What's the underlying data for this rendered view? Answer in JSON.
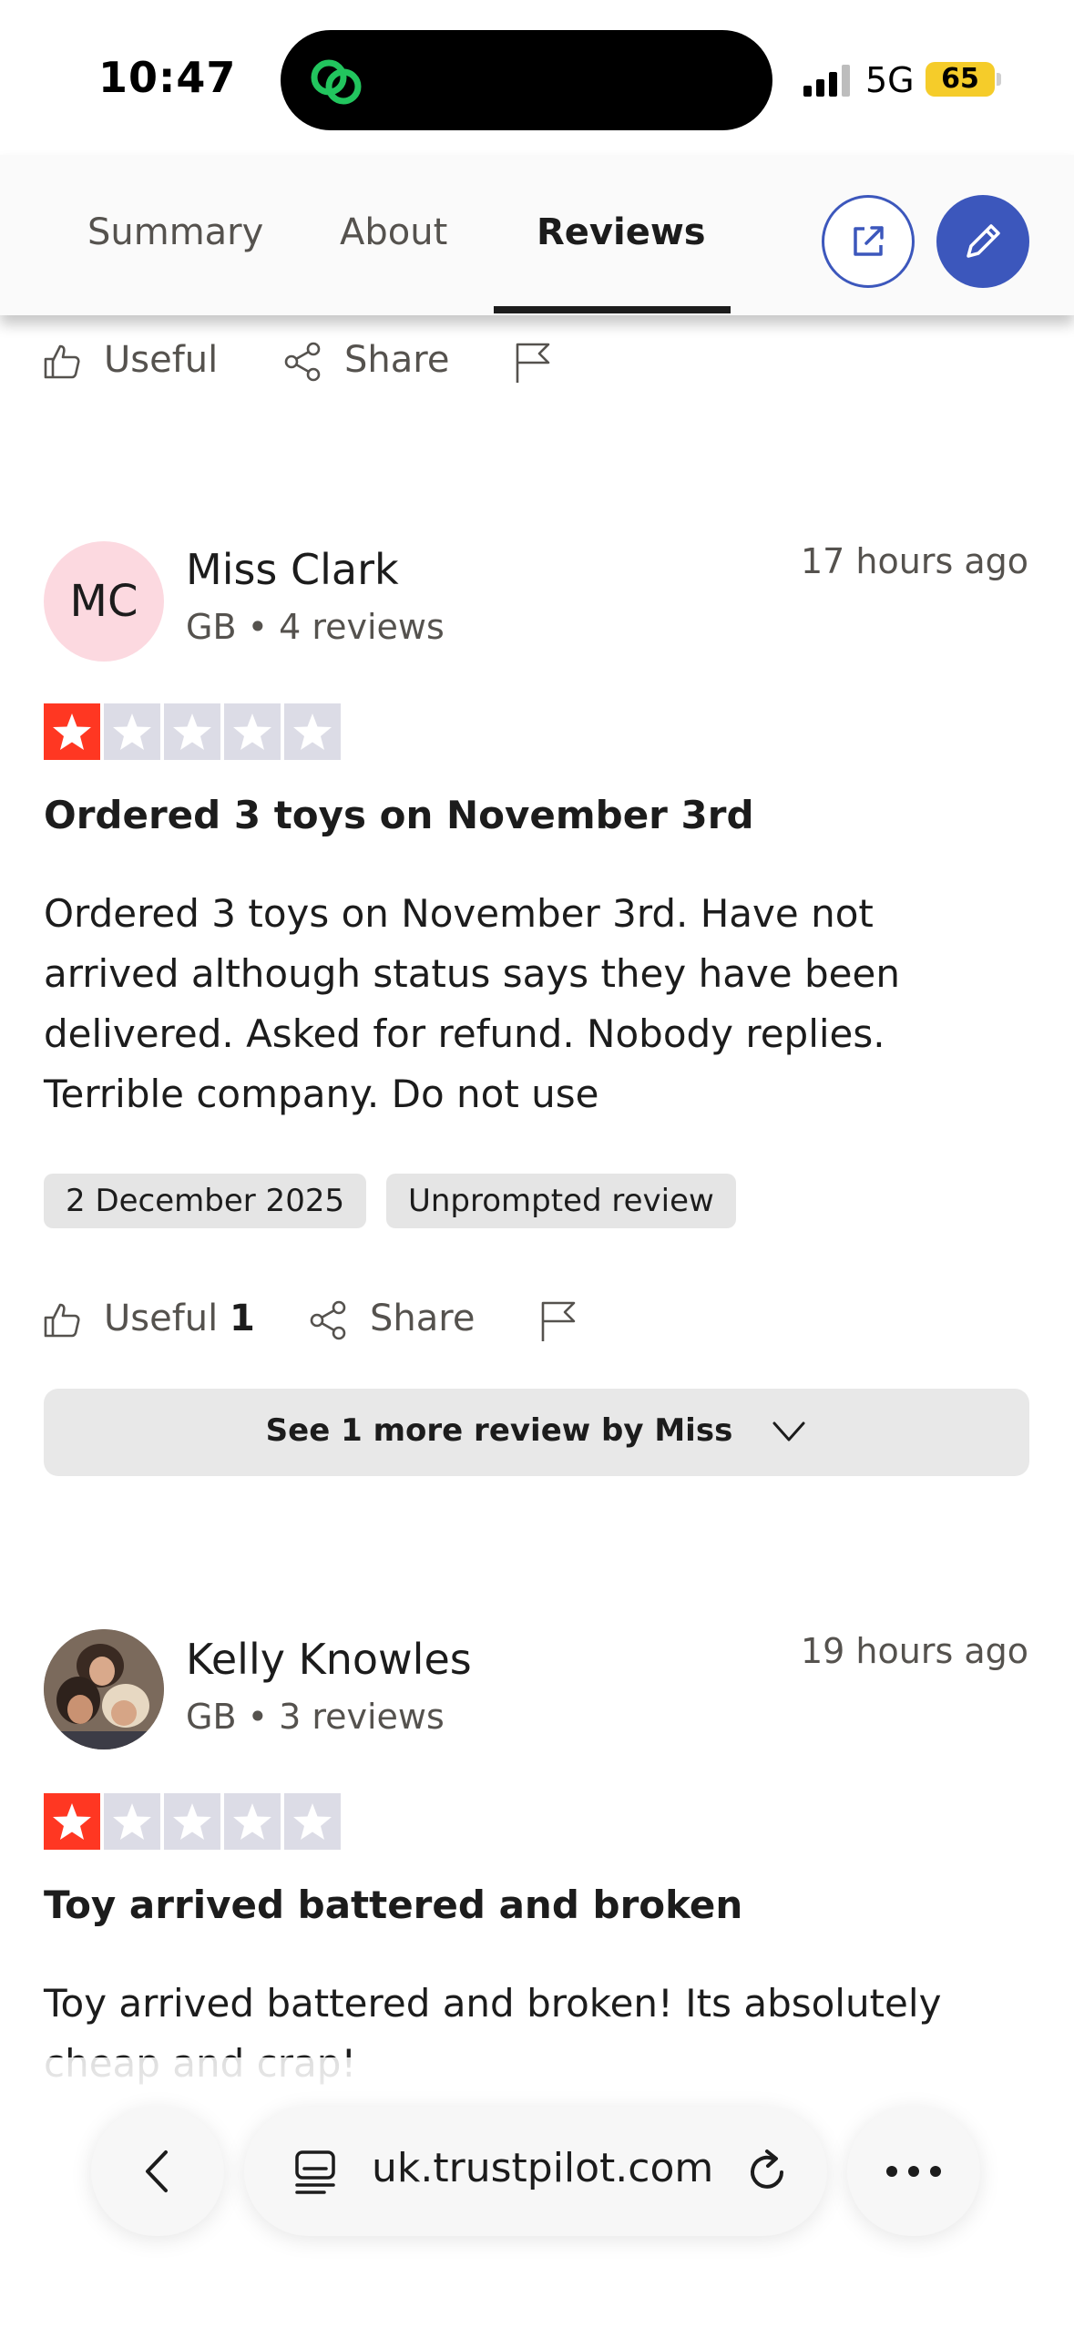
{
  "status_bar": {
    "time": "10:47",
    "network": "5G",
    "battery": "65",
    "battery_color": "#f5cc2a"
  },
  "tabs": {
    "items": [
      {
        "label": "Summary"
      },
      {
        "label": "About"
      },
      {
        "label": "Reviews"
      }
    ],
    "active": "Reviews",
    "external_icon": "external-link-icon",
    "write_icon": "pencil-icon",
    "accent_color": "#3c57bc"
  },
  "previous_review_actions": {
    "useful_label": "Useful",
    "share_label": "Share"
  },
  "reviews": [
    {
      "initials": "MC",
      "name": "Miss Clark",
      "meta": "GB • 4 reviews",
      "time": "17 hours ago",
      "rating": 1,
      "title": "Ordered 3 toys on November 3rd",
      "body": "Ordered 3 toys on November 3rd. Have not arrived although status says they have been delivered. Asked for refund. Nobody replies. Terrible company. Do not use",
      "date_chip": "2 December 2025",
      "type_chip": "Unprompted review",
      "useful_label": "Useful",
      "useful_count": "1",
      "share_label": "Share",
      "more_label": "See 1 more review by Miss"
    },
    {
      "name": "Kelly Knowles",
      "meta": "GB • 3 reviews",
      "time": "19 hours ago",
      "rating": 1,
      "title": "Toy arrived battered and broken",
      "body": "Toy arrived battered and broken! Its absolutely cheap and crap!"
    }
  ],
  "browser": {
    "url": "uk.trustpilot.com"
  },
  "colors": {
    "star_on": "#ff3722",
    "star_off": "#dcdce6"
  }
}
